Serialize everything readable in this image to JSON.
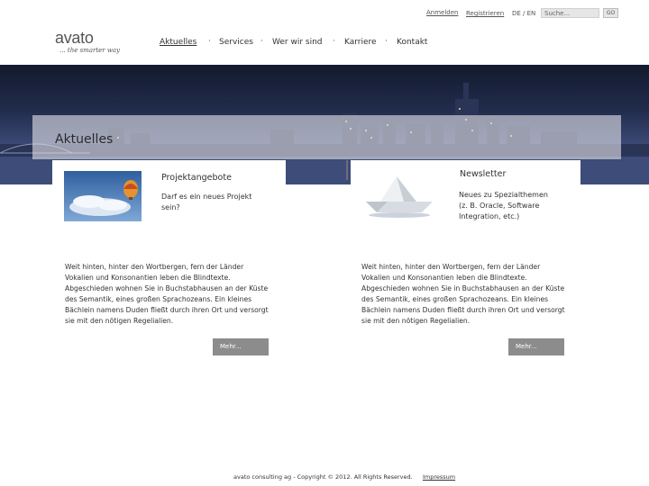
{
  "topbar": {
    "login": "Anmelden",
    "register": "Registrieren",
    "lang": "DE / EN",
    "search_placeholder": "Suche...",
    "go": "GO"
  },
  "logo": {
    "name": "avato",
    "tagline": "... the smarter way"
  },
  "nav": {
    "items": [
      "Aktuelles",
      "Services",
      "Wer wir sind",
      "Karriere",
      "Kontakt"
    ],
    "separator": "·",
    "active": "Aktuelles"
  },
  "hero": {
    "title": "Aktuelles"
  },
  "cards": [
    {
      "title": "Projektangebote",
      "subtitle": "Darf es ein neues Projekt sein?",
      "body": "Weit hinten, hinter den Wortbergen, fern der Länder Vokalien und Konsonantien leben die Blindtexte. Abgeschieden wohnen Sie in Buchstabhausen an der Küste des Semantik, eines großen Sprachozeans. Ein kleines Bächlein namens Duden fließt durch ihren Ort und versorgt sie mit den nötigen Regelialien.",
      "more": "Mehr..."
    },
    {
      "title": "Newsletter",
      "subtitle": "Neues zu Spezialthemen (z. B. Oracle, Software Integration, etc.)",
      "body": "Weit hinten, hinter den Wortbergen, fern der Länder Vokalien und Konsonantien leben die Blindtexte. Abgeschieden wohnen Sie in Buchstabhausen an der Küste des Semantik, eines großen Sprachozeans. Ein kleines Bächlein namens Duden fließt durch ihren Ort und versorgt sie mit den nötigen Regelialien.",
      "more": "Mehr..."
    }
  ],
  "footer": {
    "copyright": "avato consulting ag - Copyright © 2012. All Rights Reserved.",
    "imprint": "Impressum"
  }
}
